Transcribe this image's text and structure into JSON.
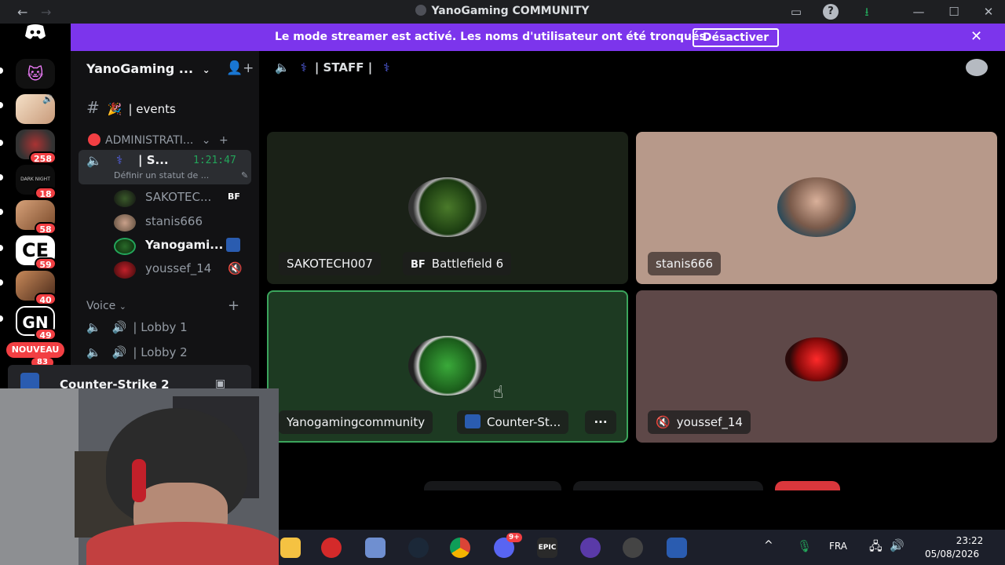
{
  "window": {
    "title": "YanoGaming COMMUNITY",
    "back": "←",
    "forward": "→"
  },
  "banner": {
    "message": "Le mode streamer est activé. Les noms d'utilisateur ont été tronqués.",
    "button": "Désactiver",
    "close": "✕"
  },
  "rail": {
    "badges": [
      "258",
      "18",
      "58",
      "59",
      "40",
      "49",
      "83"
    ],
    "new_label": "NOUVEAU"
  },
  "sidebar": {
    "server_name": "YanoGaming ...",
    "events_channel": "| events",
    "category_admin": "ADMINISTRATI...",
    "active_channel": {
      "name": "| S...",
      "timer": "1:21:47",
      "status": "Définir un statut de ..."
    },
    "members": [
      {
        "name": "SAKOTEC...",
        "badge": "BF"
      },
      {
        "name": "stanis666",
        "badge": ""
      },
      {
        "name": "Yanogami...",
        "badge": ""
      },
      {
        "name": "youssef_14",
        "badge": ""
      }
    ],
    "voice_category": "Voice",
    "voice_channels": [
      "| Lobby 1",
      "| Lobby 2"
    ],
    "activity": "Counter-Strike 2"
  },
  "channel_header": {
    "name": "| STAFF |"
  },
  "tiles": [
    {
      "user": "SAKOTECH007",
      "activity": "Battlefield 6",
      "activity_badge": "BF",
      "bg": "#1a2117"
    },
    {
      "user": "stanis666",
      "activity": "",
      "bg": "#b7998a"
    },
    {
      "user": "Yanogamingcommunity",
      "activity": "Counter-St...",
      "bg": "#1d3a22",
      "more": "···"
    },
    {
      "user": "youssef_14",
      "activity": "",
      "bg": "#5e4848"
    }
  ],
  "controls": {
    "more": "···"
  },
  "taskbar": {
    "lang": "FRA",
    "time": "23:22",
    "date": "05/08/2026",
    "discord_badge": "9+",
    "epic_label": "EPIC"
  },
  "colors": {
    "banner": "#7c35ec",
    "hangup": "#da373c",
    "accent_green": "#3ba55c"
  }
}
